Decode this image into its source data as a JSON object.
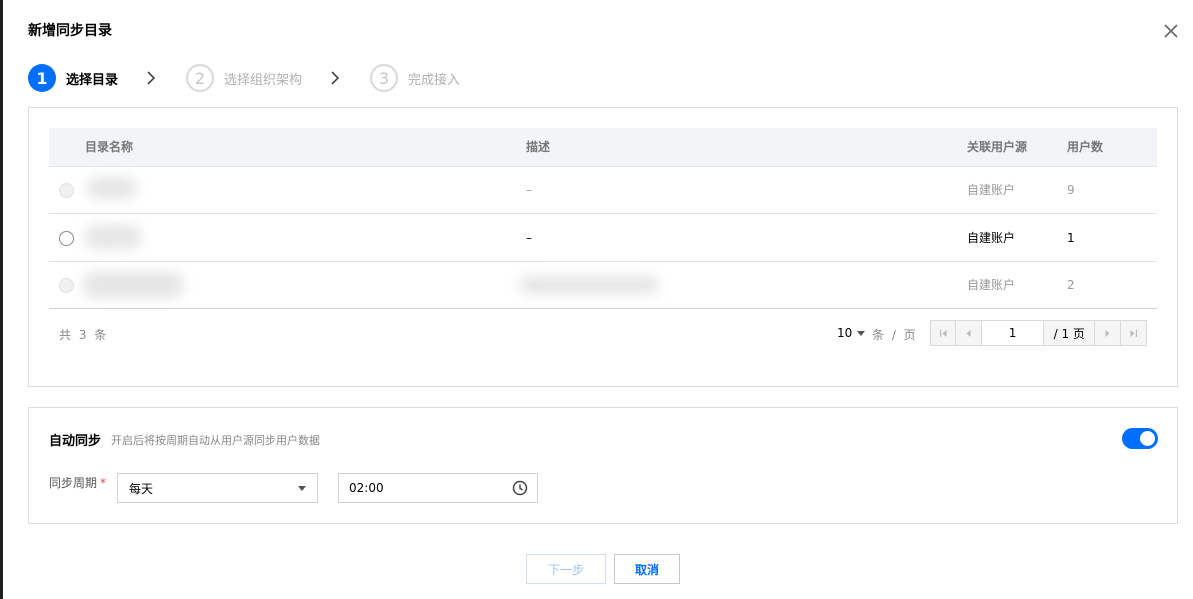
{
  "dialog": {
    "title": "新增同步目录"
  },
  "steps": [
    {
      "num": "1",
      "label": "选择目录",
      "state": "active"
    },
    {
      "num": "2",
      "label": "选择组织架构",
      "state": "inactive"
    },
    {
      "num": "3",
      "label": "完成接入",
      "state": "inactive"
    }
  ],
  "table": {
    "columns": [
      "目录名称",
      "描述",
      "关联用户源",
      "用户数"
    ],
    "rows": [
      {
        "description": "–",
        "source": "自建账户",
        "count": "9",
        "state": "disabled"
      },
      {
        "description": "–",
        "source": "自建账户",
        "count": "1",
        "state": "enabled"
      },
      {
        "description": "",
        "source": "自建账户",
        "count": "2",
        "state": "disabled"
      }
    ]
  },
  "pagination": {
    "total_text": "共 3 条",
    "page_size": "10",
    "per_page_text": "条 / 页",
    "current_page": "1",
    "total_pages_text": "/ 1 页"
  },
  "sync": {
    "title": "自动同步",
    "description": "开启后将按周期自动从用户源同步用户数据",
    "enabled": true,
    "cycle_label": "同步周期",
    "required_mark": "*",
    "cycle_value": "每天",
    "time_value": "02:00"
  },
  "footer": {
    "next_label": "下一步",
    "cancel_label": "取消"
  },
  "colors": {
    "accent": "#006eff"
  },
  "icons": [
    "close-icon",
    "chevron-right-icon",
    "first-page-icon",
    "prev-page-icon",
    "next-page-icon",
    "last-page-icon",
    "clock-icon",
    "caret-down-icon"
  ]
}
